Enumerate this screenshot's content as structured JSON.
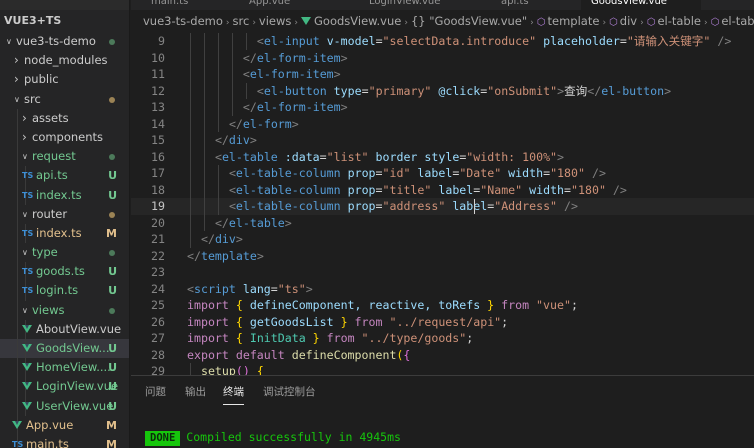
{
  "explorer": {
    "project": "VUE3+TS",
    "items": [
      {
        "label": "vue3-ts-demo",
        "kind": "folder-open",
        "level": 0,
        "status": "dot",
        "color": "normal"
      },
      {
        "label": "node_modules",
        "kind": "folder-closed",
        "level": 1,
        "status": "",
        "color": "normal"
      },
      {
        "label": "public",
        "kind": "folder-closed",
        "level": 1,
        "status": "",
        "color": "normal"
      },
      {
        "label": "src",
        "kind": "folder-open",
        "level": 1,
        "status": "dot-m",
        "color": "normal"
      },
      {
        "label": "assets",
        "kind": "folder-closed",
        "level": 2,
        "status": "",
        "color": "normal"
      },
      {
        "label": "components",
        "kind": "folder-closed",
        "level": 2,
        "status": "",
        "color": "normal"
      },
      {
        "label": "request",
        "kind": "folder-open",
        "level": 2,
        "status": "dot",
        "color": "untracked"
      },
      {
        "label": "api.ts",
        "kind": "ts",
        "level": 3,
        "status": "U",
        "color": "untracked"
      },
      {
        "label": "index.ts",
        "kind": "ts",
        "level": 3,
        "status": "U",
        "color": "untracked"
      },
      {
        "label": "router",
        "kind": "folder-open",
        "level": 2,
        "status": "dot-m",
        "color": "normal"
      },
      {
        "label": "index.ts",
        "kind": "ts",
        "level": 3,
        "status": "M",
        "color": "modified"
      },
      {
        "label": "type",
        "kind": "folder-open",
        "level": 2,
        "status": "dot",
        "color": "untracked"
      },
      {
        "label": "goods.ts",
        "kind": "ts",
        "level": 3,
        "status": "U",
        "color": "untracked"
      },
      {
        "label": "login.ts",
        "kind": "ts",
        "level": 3,
        "status": "U",
        "color": "untracked"
      },
      {
        "label": "views",
        "kind": "folder-open",
        "level": 2,
        "status": "dot",
        "color": "untracked"
      },
      {
        "label": "AboutView.vue",
        "kind": "vue",
        "level": 3,
        "status": "",
        "color": "normal"
      },
      {
        "label": "GoodsView....",
        "kind": "vue",
        "level": 3,
        "status": "U",
        "color": "untracked",
        "active": true
      },
      {
        "label": "HomeView....",
        "kind": "vue",
        "level": 3,
        "status": "U",
        "color": "untracked"
      },
      {
        "label": "LoginView.vue",
        "kind": "vue",
        "level": 3,
        "status": "U",
        "color": "untracked"
      },
      {
        "label": "UserView.vue",
        "kind": "vue",
        "level": 3,
        "status": "U",
        "color": "untracked"
      },
      {
        "label": "App.vue",
        "kind": "vue",
        "level": 2,
        "status": "M",
        "color": "modified"
      },
      {
        "label": "main.ts",
        "kind": "ts",
        "level": 2,
        "status": "M",
        "color": "modified"
      }
    ]
  },
  "tabs": [
    {
      "label": "main.ts",
      "active": false
    },
    {
      "label": "App.vue",
      "active": false
    },
    {
      "label": "LoginView.vue",
      "active": false
    },
    {
      "label": "api.ts",
      "active": false
    },
    {
      "label": "GoodsView.vue",
      "active": true
    }
  ],
  "breadcrumb": [
    "vue3-ts-demo",
    "src",
    "views",
    "GoodsView.vue",
    "{} \"GoodsView.vue\"",
    "template",
    "div",
    "el-table",
    "el-table-col"
  ],
  "editor": {
    "current_line": 19,
    "lines": [
      {
        "n": 9,
        "ind": 5,
        "t": [
          [
            "<",
            "b"
          ],
          [
            "el-input",
            "g"
          ],
          [
            " v-model",
            "a"
          ],
          [
            "=",
            "x"
          ],
          [
            "\"selectData.introduce\"",
            "s"
          ],
          [
            " placeholder",
            "a"
          ],
          [
            "=",
            "x"
          ],
          [
            "\"请输入关键字\"",
            "s"
          ],
          [
            " />",
            "b"
          ]
        ]
      },
      {
        "n": 10,
        "ind": 4,
        "t": [
          [
            "</",
            "b"
          ],
          [
            "el-form-item",
            "g"
          ],
          [
            ">",
            "b"
          ]
        ]
      },
      {
        "n": 11,
        "ind": 4,
        "t": [
          [
            "<",
            "b"
          ],
          [
            "el-form-item",
            "g"
          ],
          [
            ">",
            "b"
          ]
        ]
      },
      {
        "n": 12,
        "ind": 5,
        "t": [
          [
            "<",
            "b"
          ],
          [
            "el-button",
            "g"
          ],
          [
            " type",
            "a"
          ],
          [
            "=",
            "x"
          ],
          [
            "\"primary\"",
            "s"
          ],
          [
            " @click",
            "a"
          ],
          [
            "=",
            "x"
          ],
          [
            "\"onSubmit\"",
            "s"
          ],
          [
            ">",
            "b"
          ],
          [
            "查询",
            "x"
          ],
          [
            "</",
            "b"
          ],
          [
            "el-button",
            "g"
          ],
          [
            ">",
            "b"
          ]
        ]
      },
      {
        "n": 13,
        "ind": 4,
        "t": [
          [
            "</",
            "b"
          ],
          [
            "el-form-item",
            "g"
          ],
          [
            ">",
            "b"
          ]
        ]
      },
      {
        "n": 14,
        "ind": 3,
        "t": [
          [
            "</",
            "b"
          ],
          [
            "el-form",
            "g"
          ],
          [
            ">",
            "b"
          ]
        ]
      },
      {
        "n": 15,
        "ind": 2,
        "t": [
          [
            "</",
            "b"
          ],
          [
            "div",
            "g"
          ],
          [
            ">",
            "b"
          ]
        ]
      },
      {
        "n": 16,
        "ind": 2,
        "t": [
          [
            "<",
            "b"
          ],
          [
            "el-table",
            "g"
          ],
          [
            " :data",
            "a"
          ],
          [
            "=",
            "x"
          ],
          [
            "\"list\"",
            "s"
          ],
          [
            " border",
            "a"
          ],
          [
            " style",
            "a"
          ],
          [
            "=",
            "x"
          ],
          [
            "\"width: 100%\"",
            "s"
          ],
          [
            ">",
            "b"
          ]
        ]
      },
      {
        "n": 17,
        "ind": 3,
        "t": [
          [
            "<",
            "b"
          ],
          [
            "el-table-column",
            "g"
          ],
          [
            " prop",
            "a"
          ],
          [
            "=",
            "x"
          ],
          [
            "\"id\"",
            "s"
          ],
          [
            " label",
            "a"
          ],
          [
            "=",
            "x"
          ],
          [
            "\"Date\"",
            "s"
          ],
          [
            " width",
            "a"
          ],
          [
            "=",
            "x"
          ],
          [
            "\"180\"",
            "s"
          ],
          [
            " />",
            "b"
          ]
        ]
      },
      {
        "n": 18,
        "ind": 3,
        "t": [
          [
            "<",
            "b"
          ],
          [
            "el-table-column",
            "g"
          ],
          [
            " prop",
            "a"
          ],
          [
            "=",
            "x"
          ],
          [
            "\"title\"",
            "s"
          ],
          [
            " label",
            "a"
          ],
          [
            "=",
            "x"
          ],
          [
            "\"Name\"",
            "s"
          ],
          [
            " width",
            "a"
          ],
          [
            "=",
            "x"
          ],
          [
            "\"180\"",
            "s"
          ],
          [
            " />",
            "b"
          ]
        ]
      },
      {
        "n": 19,
        "ind": 3,
        "t": [
          [
            "<",
            "b"
          ],
          [
            "el-table-column",
            "g"
          ],
          [
            " prop",
            "a"
          ],
          [
            "=",
            "x"
          ],
          [
            "\"address\"",
            "s"
          ],
          [
            " label",
            "a"
          ],
          [
            "=",
            "x"
          ],
          [
            "\"Address\"",
            "s"
          ],
          [
            " />",
            "b"
          ]
        ]
      },
      {
        "n": 20,
        "ind": 2,
        "t": [
          [
            "</",
            "b"
          ],
          [
            "el-table",
            "g"
          ],
          [
            ">",
            "b"
          ]
        ]
      },
      {
        "n": 21,
        "ind": 1,
        "t": [
          [
            "</",
            "b"
          ],
          [
            "div",
            "g"
          ],
          [
            ">",
            "b"
          ]
        ]
      },
      {
        "n": 22,
        "ind": 0,
        "t": [
          [
            "</",
            "b"
          ],
          [
            "template",
            "g"
          ],
          [
            ">",
            "b"
          ]
        ]
      },
      {
        "n": 23,
        "ind": 0,
        "t": []
      },
      {
        "n": 24,
        "ind": 0,
        "t": [
          [
            "<",
            "b"
          ],
          [
            "script",
            "g"
          ],
          [
            " lang",
            "a"
          ],
          [
            "=",
            "x"
          ],
          [
            "\"ts\"",
            "s"
          ],
          [
            ">",
            "b"
          ]
        ]
      },
      {
        "n": 25,
        "ind": 0,
        "t": [
          [
            "import",
            "k"
          ],
          [
            " ",
            "x"
          ],
          [
            "{",
            "y"
          ],
          [
            " defineComponent, reactive, toRefs ",
            "v"
          ],
          [
            "}",
            "y"
          ],
          [
            " from ",
            "k"
          ],
          [
            "\"vue\"",
            "s"
          ],
          [
            ";",
            "x"
          ]
        ]
      },
      {
        "n": 26,
        "ind": 0,
        "t": [
          [
            "import",
            "k"
          ],
          [
            " ",
            "x"
          ],
          [
            "{",
            "y"
          ],
          [
            " getGoodsList ",
            "v"
          ],
          [
            "}",
            "y"
          ],
          [
            " from ",
            "k"
          ],
          [
            "\"../request/api\"",
            "s"
          ],
          [
            ";",
            "x"
          ]
        ]
      },
      {
        "n": 27,
        "ind": 0,
        "t": [
          [
            "import",
            "k"
          ],
          [
            " ",
            "x"
          ],
          [
            "{",
            "y"
          ],
          [
            " InitData ",
            "t"
          ],
          [
            "}",
            "y"
          ],
          [
            " from ",
            "k"
          ],
          [
            "\"../type/goods\"",
            "s"
          ],
          [
            ";",
            "x"
          ]
        ]
      },
      {
        "n": 28,
        "ind": 0,
        "t": [
          [
            "export",
            "k"
          ],
          [
            " default ",
            "k"
          ],
          [
            "defineComponent",
            "f"
          ],
          [
            "(",
            "y"
          ],
          [
            "{",
            "p"
          ]
        ]
      },
      {
        "n": 29,
        "ind": 1,
        "t": [
          [
            "setup",
            "f"
          ],
          [
            "()",
            "p"
          ],
          [
            " {",
            "y"
          ]
        ]
      }
    ]
  },
  "panel": {
    "tabs": [
      {
        "label": "问题",
        "active": false
      },
      {
        "label": "输出",
        "active": false
      },
      {
        "label": "终端",
        "active": true
      },
      {
        "label": "调试控制台",
        "active": false
      }
    ],
    "badge": "DONE",
    "message": "Compiled successfully in 4945ms"
  },
  "colors": {
    "editor_bg": "#1e1e1e",
    "sidebar_bg": "#252526",
    "tag": "#569cd6",
    "attribute": "#9cdcfe",
    "string": "#ce9178",
    "keyword": "#c586c0",
    "function": "#dcdcaa",
    "type": "#4ec9b0",
    "modified": "#e2c08d",
    "untracked": "#73c991",
    "done_badge": "#16c60c"
  }
}
